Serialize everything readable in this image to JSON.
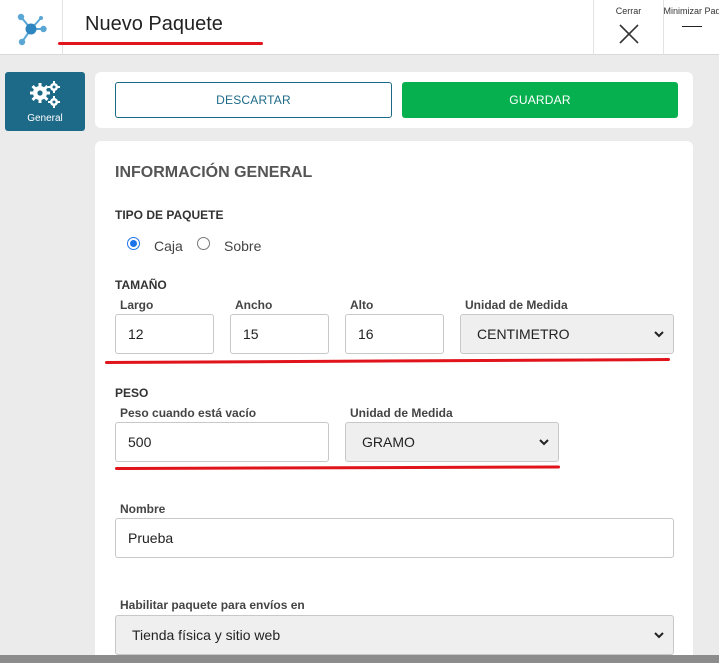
{
  "header": {
    "title": "Nuevo Paquete",
    "close_label": "Cerrar",
    "minimize_label": "Minimizar Paquete"
  },
  "sidebar": {
    "items": [
      {
        "label": "General",
        "icon": "gears-icon",
        "active": true
      }
    ]
  },
  "actions": {
    "discard_label": "DESCARTAR",
    "save_label": "GUARDAR"
  },
  "form": {
    "section_title": "INFORMACIÓN GENERAL",
    "package_type": {
      "label": "TIPO DE PAQUETE",
      "options": [
        {
          "label": "Caja",
          "checked": true
        },
        {
          "label": "Sobre",
          "checked": false
        }
      ]
    },
    "size": {
      "label": "TAMAÑO",
      "length_label": "Largo",
      "length_value": "12",
      "width_label": "Ancho",
      "width_value": "15",
      "height_label": "Alto",
      "height_value": "16",
      "unit_label": "Unidad de Medida",
      "unit_value": "CENTIMETRO"
    },
    "weight": {
      "label": "PESO",
      "empty_weight_label": "Peso cuando está vacío",
      "empty_weight_value": "500",
      "unit_label": "Unidad de Medida",
      "unit_value": "GRAMO"
    },
    "name": {
      "label": "Nombre",
      "value": "Prueba"
    },
    "enable": {
      "label": "Habilitar paquete para envíos en",
      "value": "Tienda física y sitio web"
    }
  },
  "colors": {
    "accent": "#1d6a88",
    "save": "#07b04f",
    "annotation": "#e1141c",
    "radio": "#1a73e8"
  }
}
